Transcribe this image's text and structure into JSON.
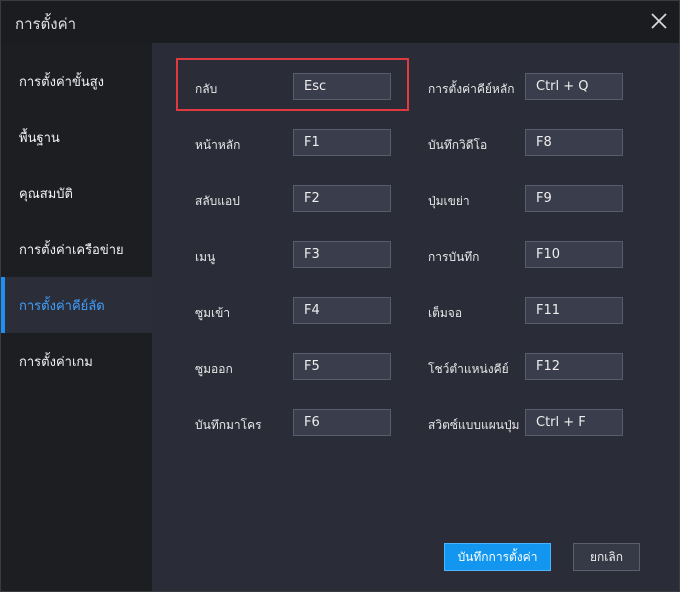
{
  "window": {
    "title": "การตั้งค่า"
  },
  "sidebar": {
    "items": [
      {
        "label": "การตั้งค่าขั้นสูง",
        "active": false
      },
      {
        "label": "พื้นฐาน",
        "active": false
      },
      {
        "label": "คุณสมบัติ",
        "active": false
      },
      {
        "label": "การตั้งค่าเครือข่าย",
        "active": false
      },
      {
        "label": "การตั้งค่าคีย์ลัด",
        "active": true
      },
      {
        "label": "การตั้งค่าเกม",
        "active": false
      }
    ]
  },
  "shortcuts": {
    "left": [
      {
        "label": "กลับ",
        "key": "Esc",
        "highlighted": true
      },
      {
        "label": "หน้าหลัก",
        "key": "F1"
      },
      {
        "label": "สลับแอป",
        "key": "F2"
      },
      {
        "label": "เมนู",
        "key": "F3"
      },
      {
        "label": "ซูมเข้า",
        "key": "F4"
      },
      {
        "label": "ซูมออก",
        "key": "F5"
      },
      {
        "label": "บันทึกมาโคร",
        "key": "F6"
      }
    ],
    "right": [
      {
        "label": "การตั้งค่าคีย์หลัก",
        "key": "Ctrl + Q"
      },
      {
        "label": "บันทึกวิดีโอ",
        "key": "F8"
      },
      {
        "label": "ปุ่มเขย่า",
        "key": "F9"
      },
      {
        "label": "การบันทึก",
        "key": "F10"
      },
      {
        "label": "เต็มจอ",
        "key": "F11"
      },
      {
        "label": "โชว์ตำแหน่งคีย์",
        "key": "F12"
      },
      {
        "label": "สวิตซ์แบบแผนปุ่ม",
        "key": "Ctrl + F"
      }
    ]
  },
  "footer": {
    "save_label": "บันทึกการตั้งค่า",
    "cancel_label": "ยกเลิก"
  },
  "colors": {
    "accent": "#1f8ff5",
    "highlight_border": "#e0393f",
    "content_bg": "#2a2c38",
    "sidebar_bg": "#1d1e22"
  }
}
